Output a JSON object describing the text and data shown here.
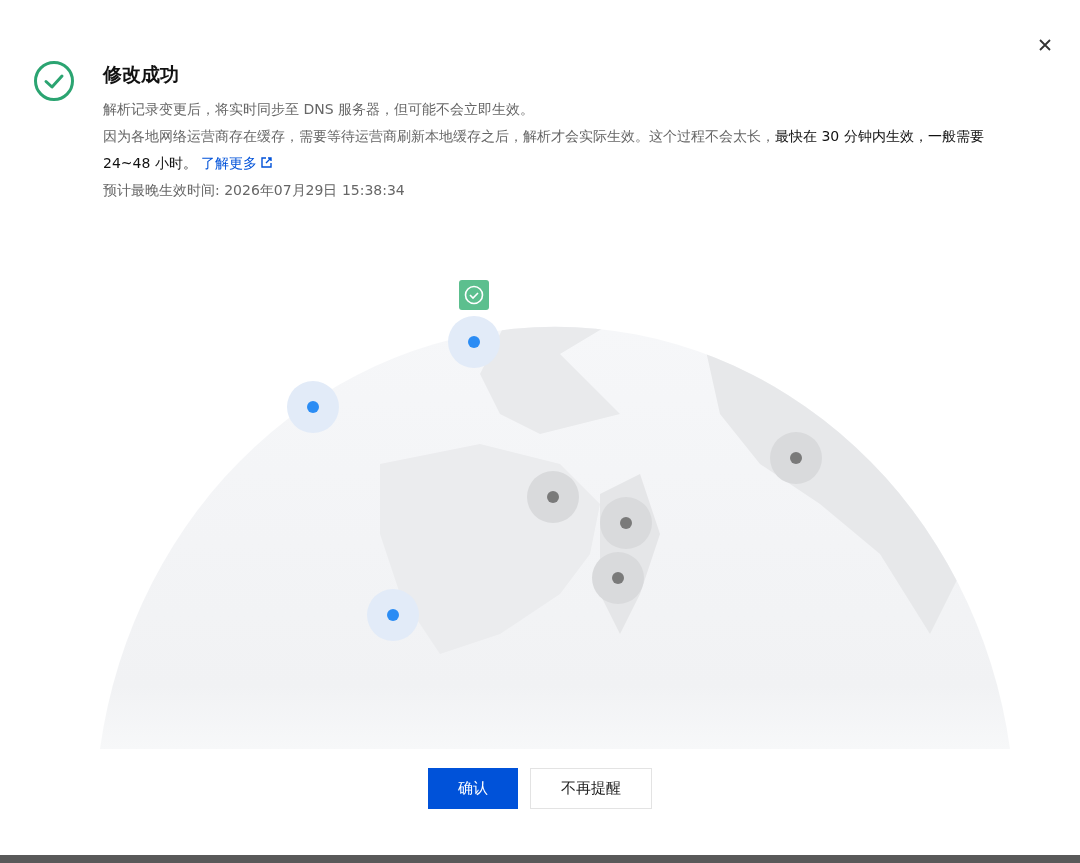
{
  "dialog": {
    "title": "修改成功",
    "lines": [
      "解析记录变更后，将实时同步至 DNS 服务器，但可能不会立即生效。"
    ],
    "notice": "因为各地网络运营商存在缓存，需要等待运营商刷新本地缓存之后，解析才会实际生效。这个过程不会太长，**最快在 30 分钟内生效，一般需要 24~48 小时。**",
    "link": "了解更多",
    "eta": "预计最晚生效时间: 2026年07月29日 15:38:34"
  },
  "map": {
    "nodes": [
      {
        "synced": true,
        "checked": true
      },
      {
        "synced": true,
        "checked": false
      },
      {
        "synced": true,
        "checked": false
      },
      {
        "synced": false,
        "checked": false
      },
      {
        "synced": false,
        "checked": false
      },
      {
        "synced": false,
        "checked": false
      },
      {
        "synced": false,
        "checked": false
      }
    ]
  },
  "buttons": [
    {
      "label": "确认",
      "primary": true
    },
    {
      "label": "不再提醒",
      "primary": false
    }
  ]
}
